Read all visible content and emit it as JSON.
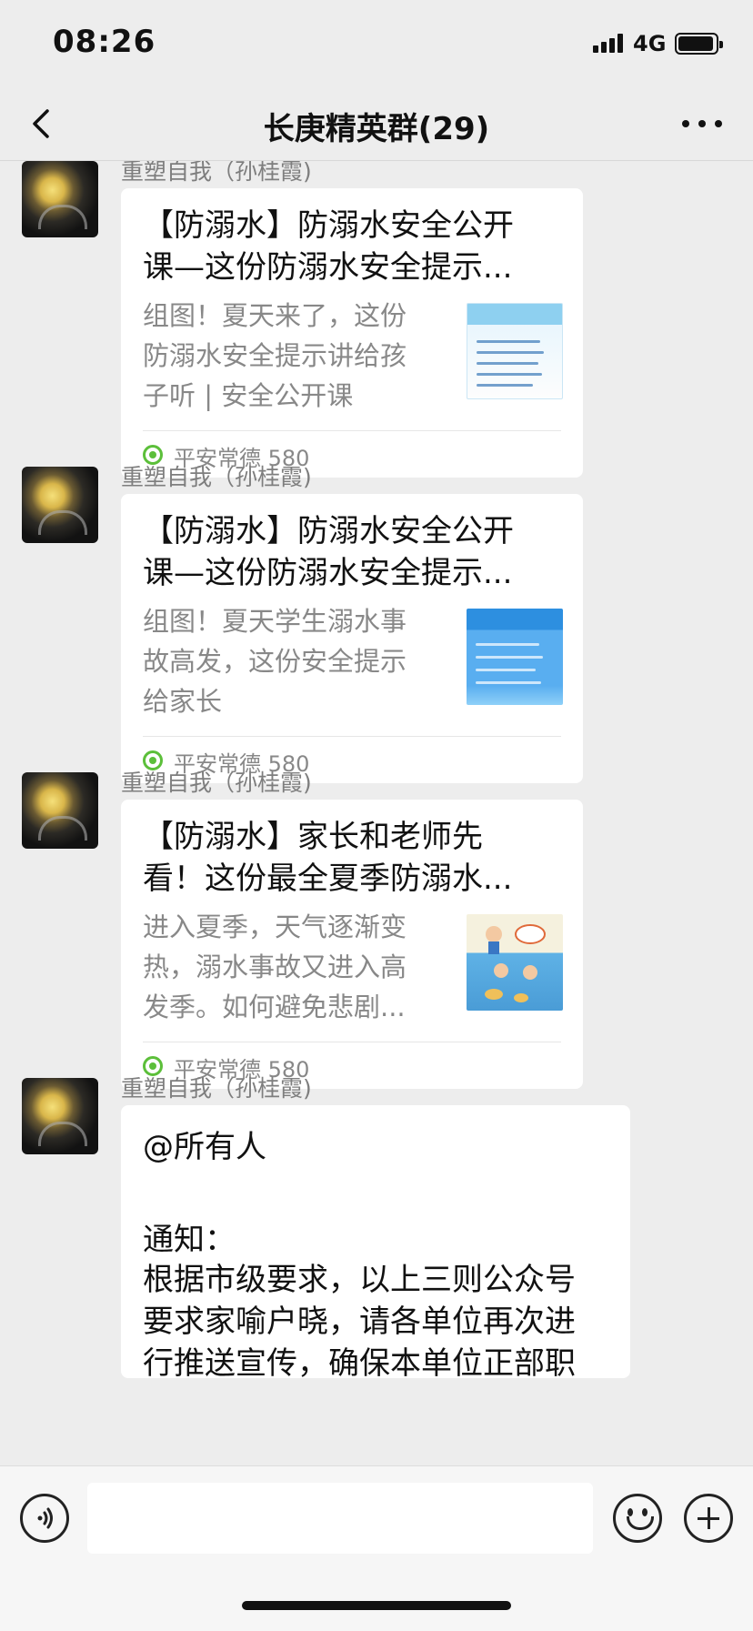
{
  "status": {
    "time": "08:26",
    "network": "4G"
  },
  "header": {
    "title": "长庚精英群(29)"
  },
  "messages": [
    {
      "sender": "重塑自我（孙桂霞)",
      "card": {
        "title": "【防溺水】防溺水安全公开课—这份防溺水安全提示...",
        "title_lines": [
          "【防溺水】防溺水安全公开",
          "课—这份防溺水安全提示..."
        ],
        "desc_lines": [
          "组图！夏天来了，这份",
          "防溺水安全提示讲给孩",
          "子听 | 安全公开课"
        ],
        "source": "平安常德 580"
      }
    },
    {
      "sender": "重塑自我（孙桂霞)",
      "card": {
        "title_lines": [
          "【防溺水】防溺水安全公开",
          "课—这份防溺水安全提示..."
        ],
        "desc_lines": [
          "组图！夏天学生溺水事",
          "故高发，这份安全提示",
          "给家长"
        ],
        "source": "平安常德 580"
      }
    },
    {
      "sender": "重塑自我（孙桂霞)",
      "card": {
        "title_lines": [
          "【防溺水】家长和老师先",
          "看！这份最全夏季防溺水..."
        ],
        "desc_lines": [
          "进入夏季，天气逐渐变",
          "热，溺水事故又进入高",
          "发季。如何避免悲剧..."
        ],
        "source": "平安常德 580"
      }
    },
    {
      "sender": "重塑自我（孙桂霞)",
      "text_lines": [
        "@所有人",
        "",
        "通知：",
        "根据市级要求，以上三则公众号",
        "要求家喻户晓，请各单位再次进",
        "行推送宣传，确保本单位正部职"
      ]
    }
  ],
  "icons": {
    "back": "chevron-left-icon",
    "more": "more-dots-icon",
    "voice": "voice-icon",
    "emoji": "emoji-icon",
    "plus": "plus-icon",
    "source": "source-logo-icon"
  }
}
